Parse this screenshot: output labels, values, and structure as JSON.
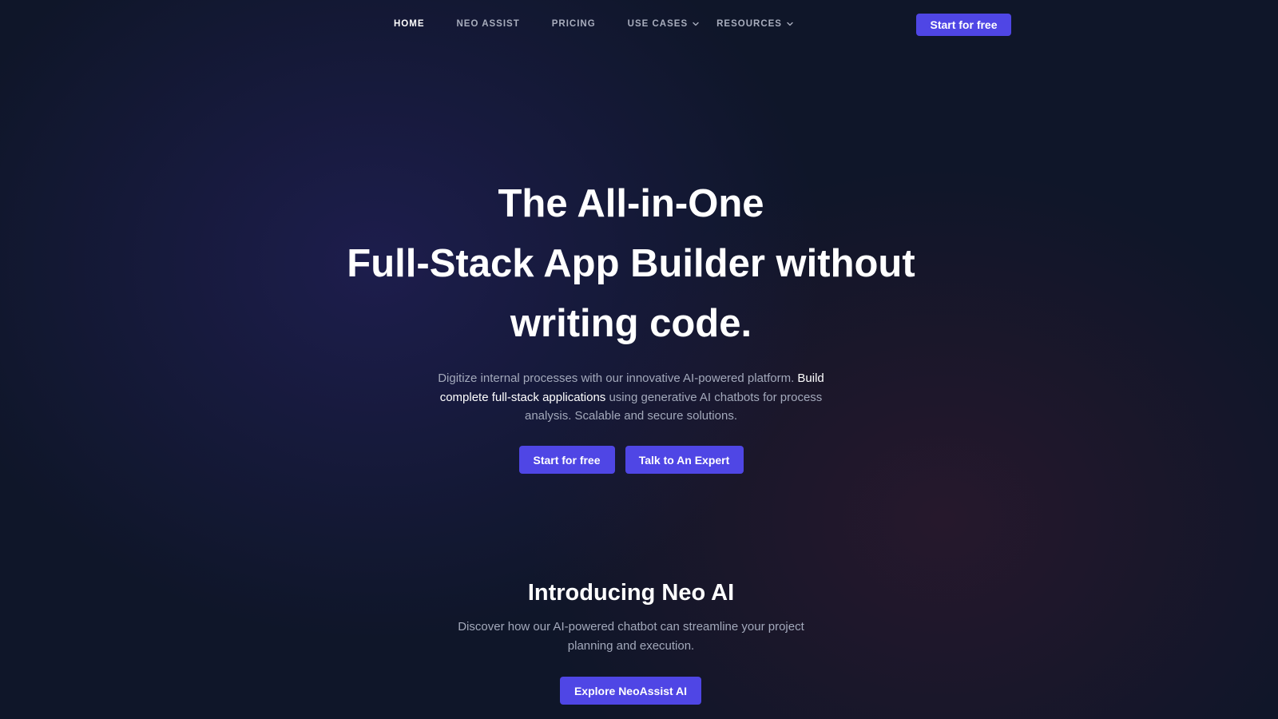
{
  "nav": {
    "items": [
      {
        "label": "HOME",
        "active": true,
        "dropdown": false
      },
      {
        "label": "NEO ASSIST",
        "active": false,
        "dropdown": false
      },
      {
        "label": "PRICING",
        "active": false,
        "dropdown": false
      },
      {
        "label": "USE CASES",
        "active": false,
        "dropdown": true
      },
      {
        "label": "RESOURCES",
        "active": false,
        "dropdown": true
      }
    ],
    "cta_label": "Start for free"
  },
  "hero": {
    "title_lines": [
      "The All-in-One",
      "Full-Stack App Builder without",
      "writing code."
    ],
    "description": {
      "part1": "Digitize internal processes with our innovative AI-powered platform.",
      "highlight": "Build complete full-stack applications",
      "part2": "using generative AI chatbots for process analysis. Scalable and secure solutions."
    },
    "primary_button": "Start for free",
    "secondary_button": "Talk to An Expert"
  },
  "neo_section": {
    "title": "Introducing Neo AI",
    "description": "Discover how our AI-powered chatbot can streamline your project planning and execution.",
    "button": "Explore NeoAssist AI"
  },
  "colors": {
    "background": "#0f1629",
    "accent": "#4f46e5",
    "text_primary": "#ffffff",
    "text_muted": "#a3a9bb"
  },
  "icons": {
    "dropdown": "chevron-down-icon"
  }
}
